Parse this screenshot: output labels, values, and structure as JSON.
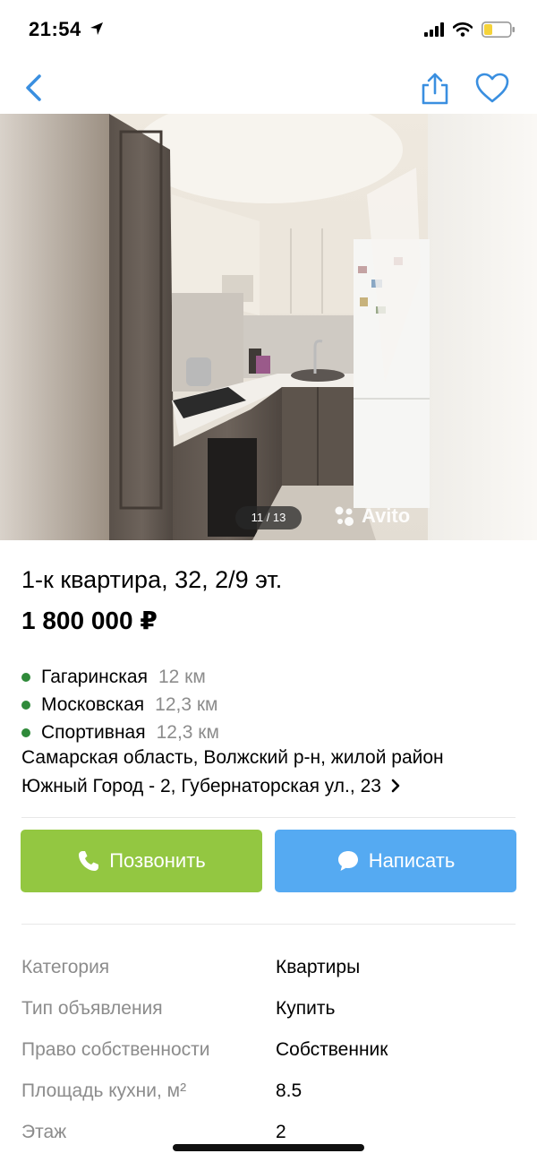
{
  "status_bar": {
    "time": "21:54",
    "battery_color": "#f5d33a"
  },
  "nav": {
    "back_icon": "chevron-left-icon",
    "share_icon": "share-icon",
    "favorite_icon": "heart-icon",
    "accent_color": "#3a8fe0"
  },
  "gallery": {
    "counter": "11 / 13",
    "watermark": "Avito"
  },
  "listing": {
    "title": "1-к квартира, 32, 2/9 эт.",
    "price": "1 800 000 ₽",
    "metro": [
      {
        "name": "Гагаринская",
        "distance": "12 км"
      },
      {
        "name": "Московская",
        "distance": "12,3 км"
      },
      {
        "name": "Спортивная",
        "distance": "12,3 км"
      }
    ],
    "address_line1": "Самарская область, Волжский р-н, жилой район",
    "address_line2": "Южный Город - 2, Губернаторская ул., 23"
  },
  "actions": {
    "call_label": "Позвонить",
    "message_label": "Написать",
    "call_color": "#93c741",
    "message_color": "#55aaf2"
  },
  "params": [
    {
      "label": "Категория",
      "value": "Квартиры"
    },
    {
      "label": "Тип объявления",
      "value": "Купить"
    },
    {
      "label": "Право собственности",
      "value": "Собственник"
    },
    {
      "label": "Площадь кухни, м²",
      "value": "8.5"
    },
    {
      "label": "Этаж",
      "value": "2"
    }
  ]
}
